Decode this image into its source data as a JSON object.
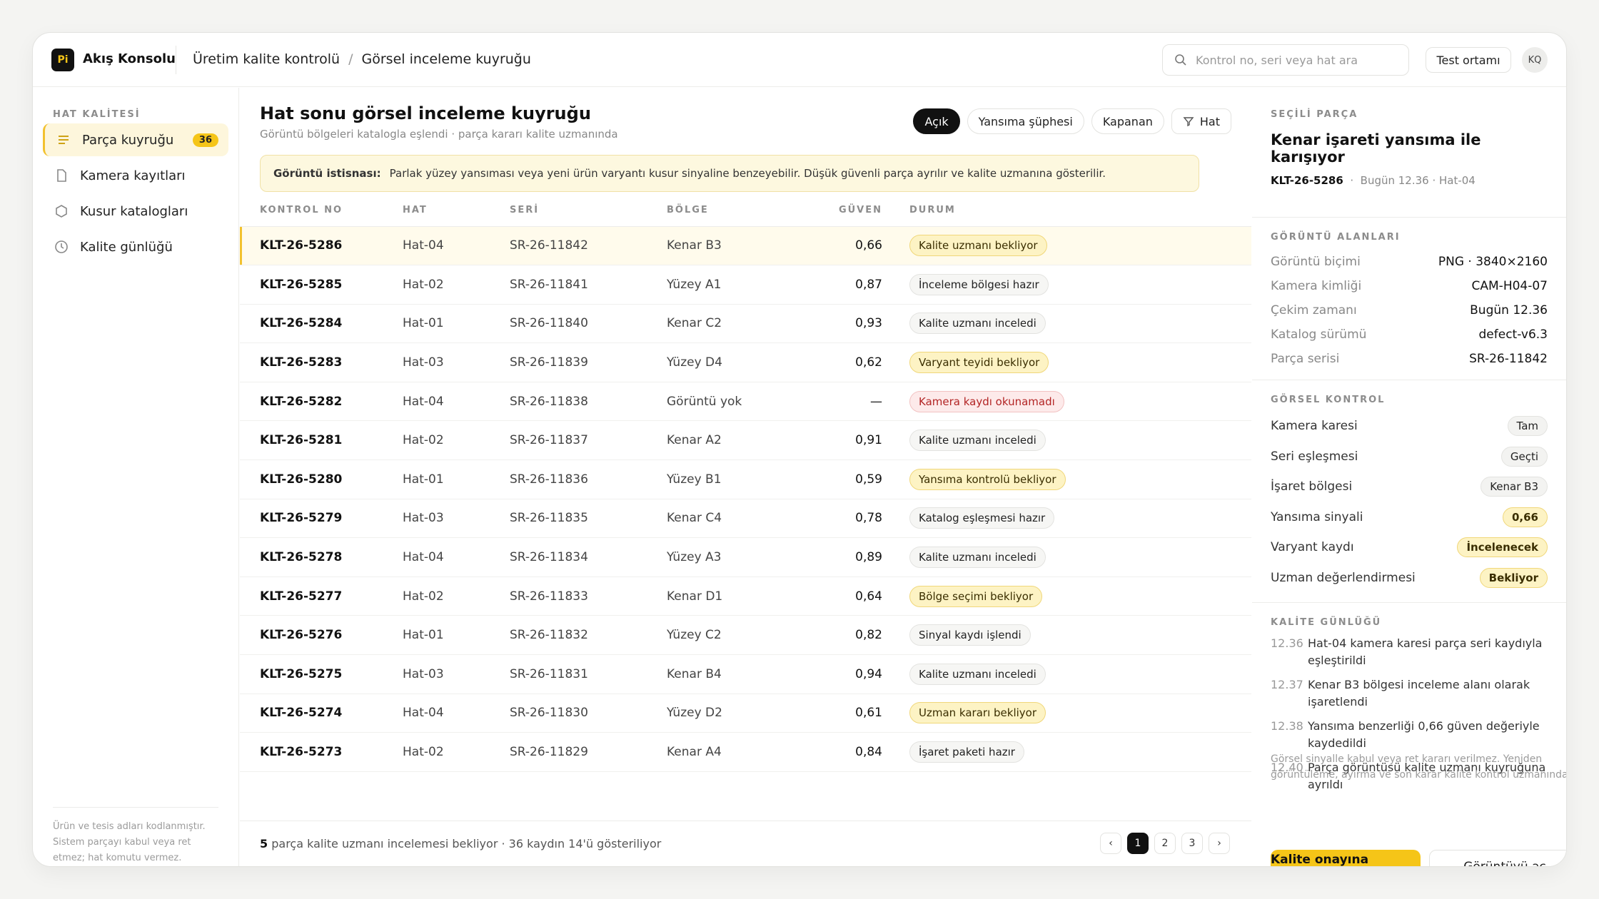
{
  "app": {
    "logo": "Pi",
    "name": "Akış Konsolu"
  },
  "breadcrumb": [
    "Üretim kalite kontrolü",
    "/",
    "Görsel inceleme kuyruğu"
  ],
  "search": {
    "placeholder": "Kontrol no, seri veya hat ara"
  },
  "env_button": "Test ortamı",
  "avatar": "KQ",
  "sidebar": {
    "title": "HAT KALİTESİ",
    "items": [
      {
        "label": "Parça kuyruğu",
        "badge": "36",
        "icon": "list-icon"
      },
      {
        "label": "Kamera kayıtları",
        "icon": "document-icon"
      },
      {
        "label": "Kusur katalogları",
        "icon": "hexagon-icon"
      },
      {
        "label": "Kalite günlüğü",
        "icon": "clock-icon"
      }
    ],
    "note": "Ürün ve tesis adları kodlanmıştır. Sistem parçayı kabul veya ret etmez; hat komutu vermez."
  },
  "main": {
    "title": "Hat sonu görsel inceleme kuyruğu",
    "subtitle": "Görüntü bölgeleri katalogla eşlendi · parça kararı kalite uzmanında",
    "filters": [
      "Açık",
      "Yansıma şüphesi",
      "Kapanan",
      "Hat"
    ],
    "alert": {
      "label": "Görüntü istisnası:",
      "text": "Parlak yüzey yansıması veya yeni ürün varyantı kusur sinyaline benzeyebilir. Düşük güvenli parça ayrılır ve kalite uzmanına gösterilir."
    },
    "columns": [
      "KONTROL NO",
      "HAT",
      "SERİ",
      "BÖLGE",
      "GÜVEN",
      "DURUM"
    ],
    "rows": [
      {
        "id": "KLT-26-5286",
        "line": "Hat-04",
        "serial": "SR-26-11842",
        "region": "Kenar B3",
        "conf": "0,66",
        "status": "Kalite uzmanı bekliyor",
        "tone": "amber"
      },
      {
        "id": "KLT-26-5285",
        "line": "Hat-02",
        "serial": "SR-26-11841",
        "region": "Yüzey A1",
        "conf": "0,87",
        "status": "İnceleme bölgesi hazır",
        "tone": "gray"
      },
      {
        "id": "KLT-26-5284",
        "line": "Hat-01",
        "serial": "SR-26-11840",
        "region": "Kenar C2",
        "conf": "0,93",
        "status": "Kalite uzmanı inceledi",
        "tone": "gray"
      },
      {
        "id": "KLT-26-5283",
        "line": "Hat-03",
        "serial": "SR-26-11839",
        "region": "Yüzey D4",
        "conf": "0,62",
        "status": "Varyant teyidi bekliyor",
        "tone": "amber"
      },
      {
        "id": "KLT-26-5282",
        "line": "Hat-04",
        "serial": "SR-26-11838",
        "region": "Görüntü yok",
        "conf": "—",
        "status": "Kamera kaydı okunamadı",
        "tone": "red"
      },
      {
        "id": "KLT-26-5281",
        "line": "Hat-02",
        "serial": "SR-26-11837",
        "region": "Kenar A2",
        "conf": "0,91",
        "status": "Kalite uzmanı inceledi",
        "tone": "gray"
      },
      {
        "id": "KLT-26-5280",
        "line": "Hat-01",
        "serial": "SR-26-11836",
        "region": "Yüzey B1",
        "conf": "0,59",
        "status": "Yansıma kontrolü bekliyor",
        "tone": "amber"
      },
      {
        "id": "KLT-26-5279",
        "line": "Hat-03",
        "serial": "SR-26-11835",
        "region": "Kenar C4",
        "conf": "0,78",
        "status": "Katalog eşleşmesi hazır",
        "tone": "gray"
      },
      {
        "id": "KLT-26-5278",
        "line": "Hat-04",
        "serial": "SR-26-11834",
        "region": "Yüzey A3",
        "conf": "0,89",
        "status": "Kalite uzmanı inceledi",
        "tone": "gray"
      },
      {
        "id": "KLT-26-5277",
        "line": "Hat-02",
        "serial": "SR-26-11833",
        "region": "Kenar D1",
        "conf": "0,64",
        "status": "Bölge seçimi bekliyor",
        "tone": "amber"
      },
      {
        "id": "KLT-26-5276",
        "line": "Hat-01",
        "serial": "SR-26-11832",
        "region": "Yüzey C2",
        "conf": "0,82",
        "status": "Sinyal kaydı işlendi",
        "tone": "gray"
      },
      {
        "id": "KLT-26-5275",
        "line": "Hat-03",
        "serial": "SR-26-11831",
        "region": "Kenar B4",
        "conf": "0,94",
        "status": "Kalite uzmanı inceledi",
        "tone": "gray"
      },
      {
        "id": "KLT-26-5274",
        "line": "Hat-04",
        "serial": "SR-26-11830",
        "region": "Yüzey D2",
        "conf": "0,61",
        "status": "Uzman kararı bekliyor",
        "tone": "amber"
      },
      {
        "id": "KLT-26-5273",
        "line": "Hat-02",
        "serial": "SR-26-11829",
        "region": "Kenar A4",
        "conf": "0,84",
        "status": "İşaret paketi hazır",
        "tone": "gray"
      }
    ],
    "footer": {
      "count": "5",
      "text": " parça kalite uzmanı incelemesi bekliyor · 36 kaydın 14'ü gösteriliyor"
    },
    "pager": [
      "‹",
      "1",
      "2",
      "3",
      "›"
    ]
  },
  "right": {
    "sel_title": "SEÇİLİ PARÇA",
    "sel_heading": "Kenar işareti yansıma ile karışıyor",
    "sel_id": "KLT-26-5286",
    "sel_meta": "Bugün 12.36 · Hat-04",
    "img_title": "GÖRÜNTÜ ALANLARI",
    "img_fields": [
      {
        "k": "Görüntü biçimi",
        "v": "PNG · 3840×2160"
      },
      {
        "k": "Kamera kimliği",
        "v": "CAM-H04-07"
      },
      {
        "k": "Çekim zamanı",
        "v": "Bugün 12.36"
      },
      {
        "k": "Katalog sürümü",
        "v": "defect-v6.3"
      },
      {
        "k": "Parça serisi",
        "v": "SR-26-11842"
      }
    ],
    "chk_title": "GÖRSEL KONTROL",
    "checks": [
      {
        "k": "Kamera karesi",
        "v": "Tam",
        "tone": "gray"
      },
      {
        "k": "Seri eşleşmesi",
        "v": "Geçti",
        "tone": "gray"
      },
      {
        "k": "İşaret bölgesi",
        "v": "Kenar B3",
        "tone": "gray"
      },
      {
        "k": "Yansıma sinyali",
        "v": "0,66",
        "tone": "amber"
      },
      {
        "k": "Varyant kaydı",
        "v": "İncelenecek",
        "tone": "amber"
      },
      {
        "k": "Uzman değerlendirmesi",
        "v": "Bekliyor",
        "tone": "amber"
      }
    ],
    "log_title": "KALİTE GÜNLÜĞÜ",
    "log": [
      {
        "t": "12.36",
        "m": "Hat-04 kamera karesi parça seri kaydıyla eşleştirildi"
      },
      {
        "t": "12.37",
        "m": "Kenar B3 bölgesi inceleme alanı olarak işaretlendi"
      },
      {
        "t": "12.38",
        "m": "Yansıma benzerliği 0,66 güven değeriyle kaydedildi"
      },
      {
        "t": "12.40",
        "m": "Parça görüntüsü kalite uzmanı kuyruğuna ayrıldı"
      }
    ],
    "note": "Görsel sinyalle kabul veya ret kararı verilmez. Yeniden görüntüleme, ayırma ve son karar kalite kontrol uzmanındadır.",
    "primary": "Kalite onayına gönder",
    "secondary": "Görüntüyü aç"
  }
}
